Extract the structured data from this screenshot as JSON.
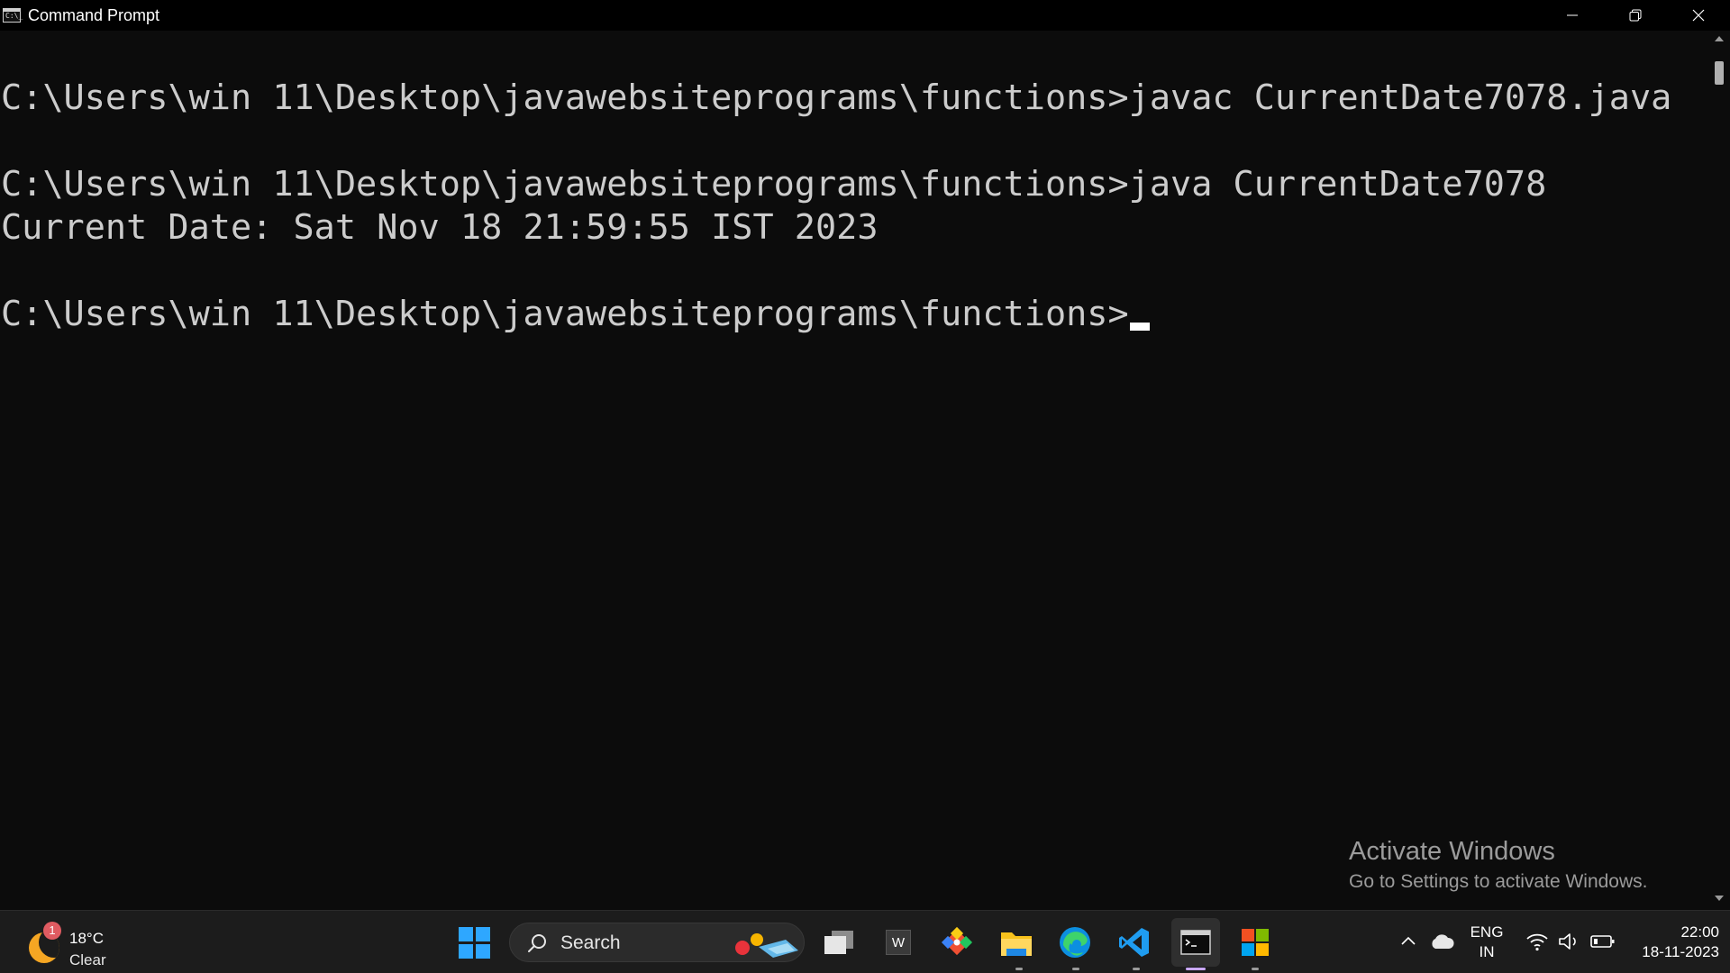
{
  "window": {
    "title": "Command Prompt",
    "icon_label": "C:\\_"
  },
  "console": {
    "lines": [
      "C:\\Users\\win 11\\Desktop\\javawebsiteprograms\\functions>javac CurrentDate7078.java",
      "C:\\Users\\win 11\\Desktop\\javawebsiteprograms\\functions>java CurrentDate7078",
      "Current Date: Sat Nov 18 21:59:55 IST 2023",
      "C:\\Users\\win 11\\Desktop\\javawebsiteprograms\\functions>"
    ]
  },
  "watermark": {
    "title": "Activate Windows",
    "subtitle": "Go to Settings to activate Windows."
  },
  "taskbar": {
    "weather": {
      "badge": "1",
      "temp": "18°C",
      "condition": "Clear"
    },
    "search": {
      "label": "Search"
    },
    "word_letter": "W",
    "tray": {
      "lang_line1": "ENG",
      "lang_line2": "IN",
      "time": "22:00",
      "date": "18-11-2023"
    }
  },
  "colors": {
    "console_bg": "#0c0c0c",
    "console_text": "#cccccc",
    "taskbar_bg": "#1c1c1c",
    "accent_blue": "#2ea7ff",
    "active_indicator": "#c8a7ff"
  }
}
